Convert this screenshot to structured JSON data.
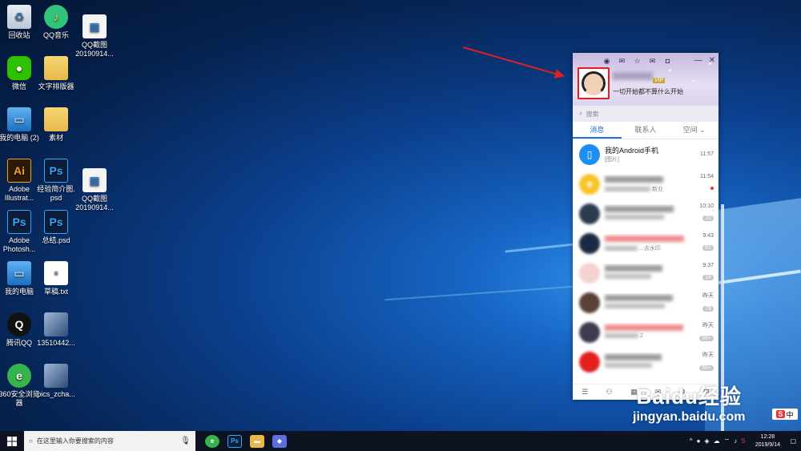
{
  "desktop_icons": [
    {
      "label": "回收站",
      "glyph": "♻",
      "icon": "recycle-bin-icon"
    },
    {
      "label": "QQ音乐",
      "glyph": "♪",
      "icon": "qq-music-icon"
    },
    {
      "label": "QQ截图\n20190914...",
      "glyph": "▦",
      "icon": "screenshot-file-icon"
    },
    {
      "label": "微信",
      "glyph": "●",
      "icon": "wechat-icon"
    },
    {
      "label": "文字排版器",
      "glyph": "",
      "icon": "folder-icon"
    },
    {
      "label": "我的电脑 (2)",
      "glyph": "▭",
      "icon": "computer-icon"
    },
    {
      "label": "素材",
      "glyph": "",
      "icon": "folder-icon"
    },
    {
      "label": "Adobe\nIllustrat...",
      "glyph": "Ai",
      "icon": "illustrator-icon"
    },
    {
      "label": "经验简介图.\npsd",
      "glyph": "Ps",
      "icon": "psd-file-icon"
    },
    {
      "label": "QQ截图\n20190914...",
      "glyph": "▦",
      "icon": "screenshot-file-icon"
    },
    {
      "label": "Adobe\nPhotosh...",
      "glyph": "Ps",
      "icon": "photoshop-icon"
    },
    {
      "label": "总结.psd",
      "glyph": "Ps",
      "icon": "psd-file-icon"
    },
    {
      "label": "我的电脑",
      "glyph": "▭",
      "icon": "computer-icon"
    },
    {
      "label": "草稿.txt",
      "glyph": "≡",
      "icon": "text-file-icon"
    },
    {
      "label": "腾讯QQ",
      "glyph": "Q",
      "icon": "qq-icon"
    },
    {
      "label": "13510442...",
      "glyph": "",
      "icon": "image-file-icon"
    },
    {
      "label": "360安全浏览\n器",
      "glyph": "e",
      "icon": "browser-360-icon"
    },
    {
      "label": "pics_zcha...",
      "glyph": "",
      "icon": "image-file-icon"
    }
  ],
  "qq": {
    "signature": "一切开始都不算什么开始",
    "level_badge": "VIP",
    "search_placeholder": "搜索",
    "tabs": [
      "消息",
      "联系人",
      "空间"
    ],
    "conversations": [
      {
        "name": "我的Android手机",
        "preview": "[图片]",
        "time": "11:57",
        "count": "",
        "avatar_color": "#1e8ff0",
        "hidden": false
      },
      {
        "name": "",
        "preview": "新业",
        "time": "11:54",
        "count": "",
        "dot": true,
        "avatar_color": "#f7c52a",
        "hidden": true
      },
      {
        "name": "",
        "preview": "",
        "time": "10:10",
        "count": "20",
        "avatar_color": "#2d3b4f",
        "hidden": true
      },
      {
        "name": "",
        "preview": "...去水印.",
        "time": "9:43",
        "count": "81",
        "avatar_color": "#1b2a44",
        "hidden": true
      },
      {
        "name": "",
        "preview": "",
        "time": "9:37",
        "count": "14",
        "avatar_color": "#f2d2d2",
        "hidden": true
      },
      {
        "name": "",
        "preview": "",
        "time": "昨天",
        "count": "79",
        "avatar_color": "#5a4038",
        "hidden": true
      },
      {
        "name": "",
        "preview": "2",
        "time": "昨天",
        "count": "99+",
        "avatar_color": "#3c3c50",
        "hidden": true
      },
      {
        "name": "",
        "preview": "",
        "time": "昨天",
        "count": "99+",
        "avatar_color": "#e32020",
        "hidden": true
      }
    ]
  },
  "watermark": {
    "brand": "Baidu经验",
    "url": "jingyan.baidu.com"
  },
  "ime": {
    "label": "中",
    "logo": "S"
  },
  "taskbar": {
    "search_placeholder": "在这里输入你要搜索的内容",
    "time": "12:28",
    "date": "2019/9/14"
  },
  "colors": {
    "accent": "#1e6fe0",
    "annotation": "#e02020",
    "taskbar": "#0d1320"
  }
}
